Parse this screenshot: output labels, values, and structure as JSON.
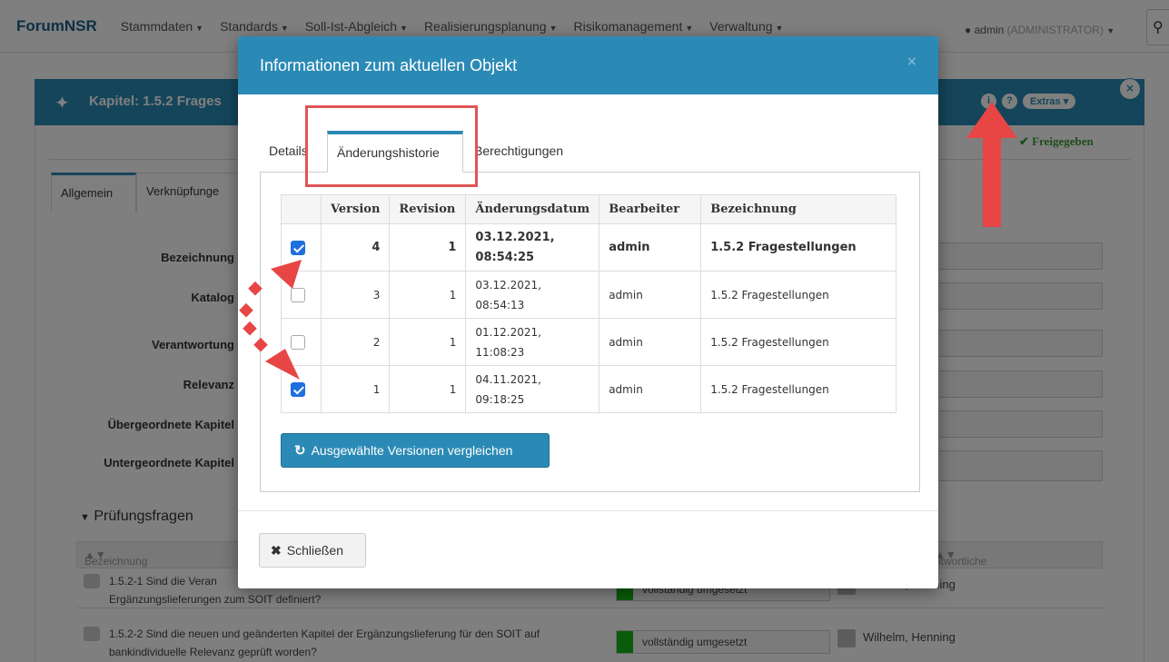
{
  "navbar": {
    "brand_prefix": "Forum",
    "brand_suffix": "NSR",
    "items": [
      {
        "label": "Stammdaten"
      },
      {
        "label": "Standards"
      },
      {
        "label": "Soll-Ist-Abgleich"
      },
      {
        "label": "Realisierungsplanung"
      },
      {
        "label": "Risikomanagement"
      },
      {
        "label": "Verwaltung"
      }
    ],
    "user_name": "admin",
    "user_role": "(ADMINISTRATOR)",
    "search_icon": "search-icon"
  },
  "panel": {
    "title": "Kapitel: 1.5.2 Frages",
    "status": "Freigegeben",
    "extras_label": "Extras",
    "info_icon": "i",
    "help_icon": "?",
    "close_icon": "×"
  },
  "background": {
    "tabs": [
      "Allgemein",
      "Verknüpfunge"
    ],
    "labels": [
      "Bezeichnung",
      "Katalog",
      "Verantwortung",
      "Relevanz",
      "Übergeordnete Kapitel",
      "Untergeordnete Kapitel"
    ],
    "section_title": "Prüfungsfragen",
    "col_bezeichnung": "Bezeichnung",
    "col_verantwortliche": "ntwortliche",
    "rows": [
      {
        "text": "1.5.2-1 Sind die Veran\nErgänzungslieferungen zum SOIT definiert?",
        "status": "vollständig umgesetzt",
        "person": "Wilhelm, Henning"
      },
      {
        "text": "1.5.2-2 Sind die neuen und geänderten Kapitel der Ergänzungslieferung für den SOIT auf bankindividuelle Relevanz geprüft worden?",
        "status": "vollständig umgesetzt",
        "person": "Wilhelm, Henning"
      }
    ]
  },
  "modal": {
    "title": "Informationen zum aktuellen Objekt",
    "close_glyph": "×",
    "tabs": [
      "Details",
      "Änderungshistorie",
      "Berechtigungen"
    ],
    "table": {
      "headers": [
        "",
        "Version",
        "Revision",
        "Änderungsdatum",
        "Bearbeiter",
        "Bezeichnung"
      ],
      "rows": [
        {
          "checked": true,
          "version": "4",
          "revision": "1",
          "date1": "03.12.2021,",
          "date2": "08:54:25",
          "editor": "admin",
          "name": "1.5.2 Fragestellungen"
        },
        {
          "checked": false,
          "version": "3",
          "revision": "1",
          "date1": "03.12.2021,",
          "date2": "08:54:13",
          "editor": "admin",
          "name": "1.5.2 Fragestellungen"
        },
        {
          "checked": false,
          "version": "2",
          "revision": "1",
          "date1": "01.12.2021,",
          "date2": "11:08:23",
          "editor": "admin",
          "name": "1.5.2 Fragestellungen"
        },
        {
          "checked": true,
          "version": "1",
          "revision": "1",
          "date1": "04.11.2021,",
          "date2": "09:18:25",
          "editor": "admin",
          "name": "1.5.2 Fragestellungen"
        }
      ]
    },
    "compare_label": "Ausgewählte Versionen vergleichen",
    "close_label": "Schließen"
  },
  "colors": {
    "primary": "#2b8ab5",
    "highlight": "#e05555",
    "success": "#12b812"
  }
}
